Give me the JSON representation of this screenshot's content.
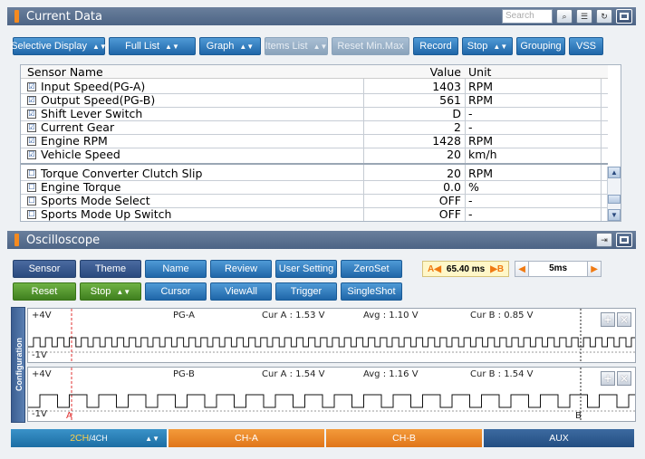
{
  "current_data": {
    "title": "Current Data",
    "search_placeholder": "Search",
    "toolbar": {
      "selective_display": "Selective Display",
      "full_list": "Full List",
      "graph": "Graph",
      "items_list": "Items List",
      "reset_min_max": "Reset Min.Max",
      "record": "Record",
      "stop": "Stop",
      "grouping": "Grouping",
      "vss": "VSS"
    },
    "columns": {
      "name": "Sensor Name",
      "value": "Value",
      "unit": "Unit"
    },
    "rows": [
      {
        "name": "Input Speed(PG-A)",
        "value": "1403",
        "unit": "RPM",
        "checked": "☑"
      },
      {
        "name": "Output Speed(PG-B)",
        "value": "561",
        "unit": "RPM",
        "checked": "☑"
      },
      {
        "name": "Shift Lever Switch",
        "value": "D",
        "unit": "-",
        "checked": "☑"
      },
      {
        "name": "Current Gear",
        "value": "2",
        "unit": "-",
        "checked": "☑"
      },
      {
        "name": "Engine RPM",
        "value": "1428",
        "unit": "RPM",
        "checked": "☑"
      },
      {
        "name": "Vehicle Speed",
        "value": "20",
        "unit": "km/h",
        "checked": "☑"
      },
      {
        "name": "Torque Converter Clutch Slip",
        "value": "20",
        "unit": "RPM",
        "checked": "☐"
      },
      {
        "name": "Engine Torque",
        "value": "0.0",
        "unit": "%",
        "checked": "☐"
      },
      {
        "name": "Sports Mode Select",
        "value": "OFF",
        "unit": "-",
        "checked": "☐"
      },
      {
        "name": "Sports Mode Up Switch",
        "value": "OFF",
        "unit": "-",
        "checked": "☐"
      }
    ]
  },
  "oscilloscope": {
    "title": "Oscilloscope",
    "toolbar_row1": {
      "sensor": "Sensor",
      "theme": "Theme",
      "name": "Name",
      "review": "Review",
      "user_setting": "User Setting",
      "zeroset": "ZeroSet"
    },
    "toolbar_row2": {
      "reset": "Reset",
      "stop": "Stop",
      "cursor": "Cursor",
      "viewall": "ViewAll",
      "trigger": "Trigger",
      "singleshot": "SingleShot"
    },
    "cursor_a_label": "A",
    "cursor_delta": "65.40 ms",
    "cursor_b_label": "B",
    "timebase": "5ms",
    "config_label": "Configuration",
    "channels": [
      {
        "max": "+4V",
        "min": "-1V",
        "name": "PG-A",
        "cur_a": "Cur A : 1.53 V",
        "avg": "Avg : 1.10 V",
        "cur_b": "Cur B : 0.85 V"
      },
      {
        "max": "+4V",
        "min": "-1V",
        "name": "PG-B",
        "cur_a": "Cur A : 1.54 V",
        "avg": "Avg : 1.16 V",
        "cur_b": "Cur B : 1.54 V"
      }
    ],
    "marker_a": "A",
    "marker_b": "B",
    "bottom": {
      "ch_count": "2CH",
      "ch_total": "4CH",
      "ch_a": "CH-A",
      "ch_b": "CH-B",
      "aux": "AUX"
    }
  },
  "colors": {
    "header": "#4c6485",
    "accent": "#f58a1f",
    "button_blue": "#1f66a8",
    "button_green": "#3f7f1f"
  }
}
